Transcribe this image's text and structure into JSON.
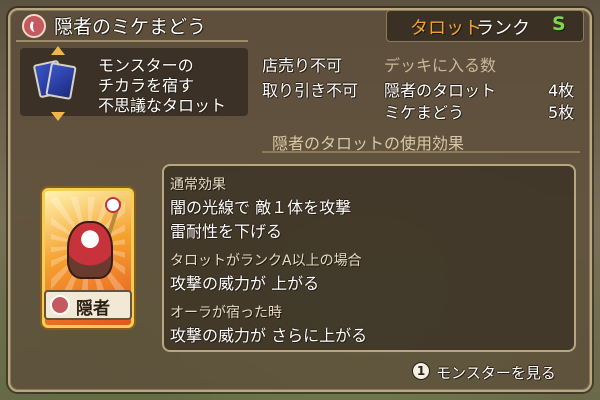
{
  "header": {
    "title": "隠者のミケまどう",
    "category": "タロット",
    "rank_label": "ランク",
    "rank_value": "S"
  },
  "card_info": {
    "description_lines": [
      "モンスターの",
      "チカラを宿す",
      "不思議なタロット"
    ]
  },
  "trade": {
    "sell": "店売り不可",
    "trade": "取り引き不可"
  },
  "deck": {
    "heading": "デッキに入る数",
    "items": [
      {
        "name": "隠者のタロット",
        "count": "4枚"
      },
      {
        "name": "ミケまどう",
        "count": "5枚"
      }
    ]
  },
  "effects": {
    "heading": "隠者のタロットの使用効果",
    "normal_label": "通常効果",
    "normal_lines": [
      "闇の光線で 敵１体を攻撃",
      "雷耐性を下げる"
    ],
    "rank_condition": "タロットがランクA以上の場合",
    "rank_effect": "攻撃の威力が 上がる",
    "aura_condition": "オーラが宿った時",
    "aura_effect": "攻撃の威力が さらに上がる"
  },
  "card": {
    "tag_label": "隠者"
  },
  "footer": {
    "button_glyph": "1",
    "button_label": "モンスターを見る"
  },
  "colors": {
    "category": "#f0a23a",
    "rank": "#7ed94a",
    "accent_red": "#c45a60"
  }
}
